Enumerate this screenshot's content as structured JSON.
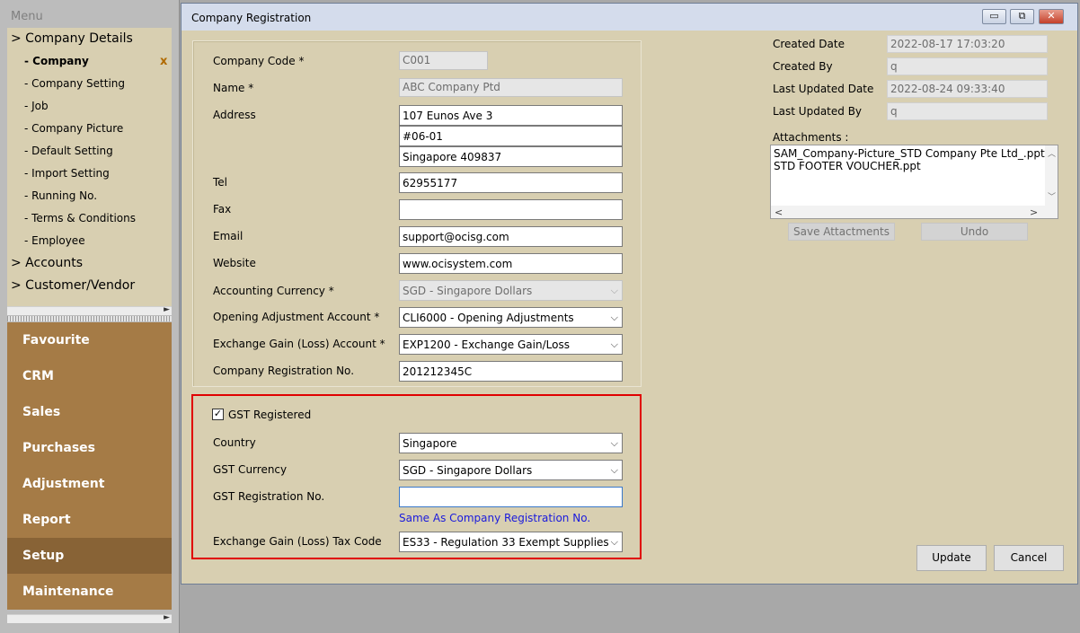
{
  "menu": {
    "title": "Menu",
    "tree": [
      {
        "label": "> Company Details",
        "level": 0
      },
      {
        "label": "- Company",
        "level": 1,
        "active": true
      },
      {
        "label": "- Company Setting",
        "level": 1
      },
      {
        "label": "- Job",
        "level": 1
      },
      {
        "label": "- Company Picture",
        "level": 1
      },
      {
        "label": "- Default Setting",
        "level": 1
      },
      {
        "label": "- Import Setting",
        "level": 1
      },
      {
        "label": "- Running No.",
        "level": 1
      },
      {
        "label": "- Terms & Conditions",
        "level": 1
      },
      {
        "label": "- Employee",
        "level": 1
      },
      {
        "label": "> Accounts",
        "level": 0
      },
      {
        "label": "> Customer/Vendor",
        "level": 0
      }
    ],
    "close_glyph": "x",
    "modules": [
      "Favourite",
      "CRM",
      "Sales",
      "Purchases",
      "Adjustment",
      "Report",
      "Setup",
      "Maintenance"
    ],
    "selected_module": "Setup"
  },
  "dialog": {
    "title": "Company Registration",
    "window_buttons": {
      "minimize": "▭",
      "restore": "⧉",
      "close": "✕"
    }
  },
  "form": {
    "company_code": {
      "label": "Company Code *",
      "value": "C001"
    },
    "name": {
      "label": "Name *",
      "value": "ABC Company Ptd"
    },
    "address": {
      "label": "Address",
      "line1": "107 Eunos Ave 3",
      "line2": "#06-01",
      "line3": "Singapore 409837"
    },
    "tel": {
      "label": "Tel",
      "value": "62955177"
    },
    "fax": {
      "label": "Fax",
      "value": ""
    },
    "email": {
      "label": "Email",
      "value": "support@ocisg.com"
    },
    "website": {
      "label": "Website",
      "value": "www.ocisystem.com"
    },
    "accounting_currency": {
      "label": "Accounting Currency *",
      "value": "SGD - Singapore Dollars"
    },
    "opening_adjustment": {
      "label": "Opening Adjustment Account *",
      "value": "CLI6000 - Opening Adjustments"
    },
    "exchange_gain": {
      "label": "Exchange Gain (Loss) Account *",
      "value": "EXP1200 - Exchange Gain/Loss"
    },
    "company_reg_no": {
      "label": "Company Registration No.",
      "value": "201212345C"
    }
  },
  "gst": {
    "checkbox_label": "GST Registered",
    "checked": true,
    "check_glyph": "✓",
    "country": {
      "label": "Country",
      "value": "Singapore"
    },
    "currency": {
      "label": "GST Currency",
      "value": "SGD - Singapore Dollars"
    },
    "reg_no": {
      "label": "GST Registration No.",
      "value": ""
    },
    "same_as_link": "Same As Company Registration No.",
    "tax_code": {
      "label": "Exchange Gain (Loss) Tax Code",
      "value": "ES33 - Regulation 33 Exempt Supplies"
    }
  },
  "audit": {
    "created_date": {
      "label": "Created Date",
      "value": "2022-08-17 17:03:20"
    },
    "created_by": {
      "label": "Created By",
      "value": "q"
    },
    "updated_date": {
      "label": "Last Updated Date",
      "value": "2022-08-24 09:33:40"
    },
    "updated_by": {
      "label": "Last Updated By",
      "value": "q"
    }
  },
  "attachments": {
    "label": "Attachments :",
    "files": [
      "SAM_Company-Picture_STD Company Pte Ltd_.pptx",
      "STD FOOTER VOUCHER.ppt"
    ],
    "save_label": "Save Attactments",
    "undo_label": "Undo"
  },
  "actions": {
    "update_label": "Update",
    "cancel_label": "Cancel"
  },
  "glyphs": {
    "dropdown": "⌵",
    "scroll_right": "►",
    "scroll_left": "<",
    "scroll_right_small": ">",
    "scroll_up": "︿",
    "scroll_down": "﹀"
  },
  "colors": {
    "module_bg": "#a57b46",
    "module_selected_bg": "#886336",
    "panel_bg": "#d8cfb1",
    "gst_highlight": "#e00000",
    "link": "#1a1add"
  }
}
